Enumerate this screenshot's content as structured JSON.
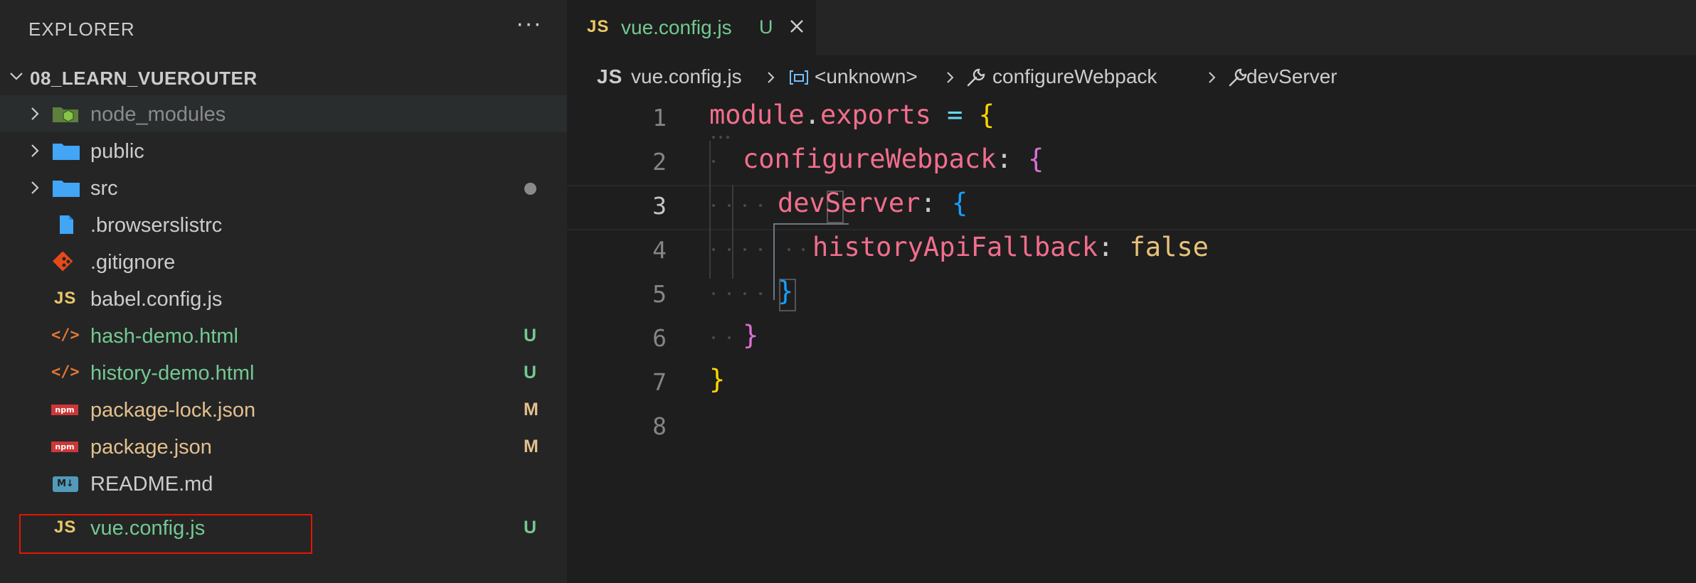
{
  "explorer": {
    "title": "EXPLORER",
    "more": "···",
    "root": "08_LEARN_VUEROUTER",
    "items": [
      {
        "label": "node_modules",
        "kind": "folder",
        "icon": "node-folder-icon",
        "status": "",
        "state": "ignored"
      },
      {
        "label": "public",
        "kind": "folder",
        "icon": "folder-icon",
        "status": "",
        "state": "normal"
      },
      {
        "label": "src",
        "kind": "folder",
        "icon": "folder-icon",
        "status": "dot",
        "state": "normal"
      },
      {
        "label": ".browserslistrc",
        "kind": "file",
        "icon": "file-icon",
        "status": "",
        "state": "normal"
      },
      {
        "label": ".gitignore",
        "kind": "file",
        "icon": "git-icon",
        "status": "",
        "state": "normal"
      },
      {
        "label": "babel.config.js",
        "kind": "file",
        "icon": "js-icon",
        "status": "",
        "state": "normal"
      },
      {
        "label": "hash-demo.html",
        "kind": "file",
        "icon": "html-icon",
        "status": "U",
        "state": "untracked"
      },
      {
        "label": "history-demo.html",
        "kind": "file",
        "icon": "html-icon",
        "status": "U",
        "state": "untracked"
      },
      {
        "label": "package-lock.json",
        "kind": "file",
        "icon": "npm-icon",
        "status": "M",
        "state": "modified"
      },
      {
        "label": "package.json",
        "kind": "file",
        "icon": "npm-icon",
        "status": "M",
        "state": "modified"
      },
      {
        "label": "README.md",
        "kind": "file",
        "icon": "markdown-icon",
        "status": "",
        "state": "normal"
      },
      {
        "label": "vue.config.js",
        "kind": "file",
        "icon": "js-icon",
        "status": "U",
        "state": "untracked"
      }
    ],
    "icon_text": {
      "js": "JS",
      "npm": "npm",
      "md": "M↓",
      "html": "</>"
    }
  },
  "tab": {
    "icon": "JS",
    "name": "vue.config.js",
    "status": "U"
  },
  "breadcrumb": {
    "file_icon": "JS",
    "file": "vue.config.js",
    "symbol1": "<unknown>",
    "symbol2": "configureWebpack",
    "symbol3": "devServer"
  },
  "editor": {
    "line_numbers": [
      "1",
      "2",
      "3",
      "4",
      "5",
      "6",
      "7",
      "8"
    ],
    "active_line": "3",
    "code": {
      "l1_module": "module",
      "l1_dot": ".",
      "l1_exports": "exports",
      "l1_eq": "=",
      "l1_brace": "{",
      "l2_key": "configureWebpack",
      "l2_colon": ":",
      "l2_brace": "{",
      "l3_key": "devServer",
      "l3_colon": ":",
      "l3_brace": "{",
      "l4_key": "historyApiFallback",
      "l4_colon": ":",
      "l4_value": "false",
      "l5_brace": "}",
      "l6_brace": "}",
      "l7_brace": "}"
    }
  },
  "colors": {
    "untracked": "#73c991",
    "modified": "#e2c08d",
    "selection_box": "#e51400"
  }
}
